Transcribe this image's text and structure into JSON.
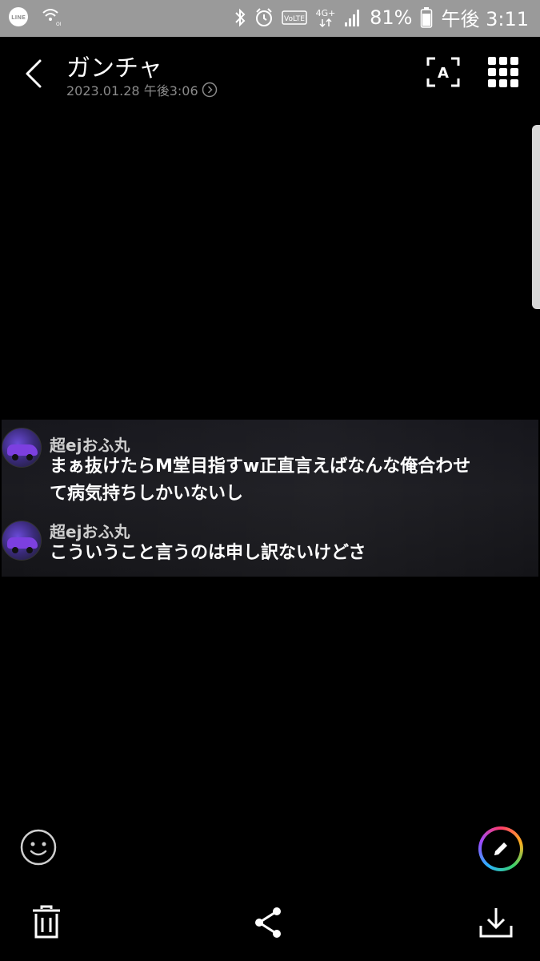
{
  "status_bar": {
    "battery_percent": "81%",
    "time": "午後 3:11",
    "network": "4G+",
    "volte": "VoLTE",
    "left_icons": [
      "line-icon",
      "wifi-calling-icon"
    ],
    "right_icons": [
      "bluetooth-icon",
      "alarm-icon",
      "volte-icon",
      "network-4g-icon",
      "signal-icon",
      "battery-icon"
    ]
  },
  "header": {
    "title": "ガンチャ",
    "subtitle": "2023.01.28 午後3:06"
  },
  "chat_image": {
    "messages": [
      {
        "sender": "超ejおふ丸",
        "text_line1": "まぁ抜けたらM堂目指すw正直言えばなんな俺合わせ",
        "text_line2": "て病気持ちしかいないし"
      },
      {
        "sender": "超ejおふ丸",
        "text_line1": "こういうこと言うのは申し訳ないけどさ"
      }
    ]
  },
  "toolbar": {
    "items": [
      "trash-icon",
      "share-icon",
      "download-icon"
    ]
  },
  "colors": {
    "background": "#000000",
    "status_bar": "#9a9a9a",
    "subtitle": "#8a8a8a"
  }
}
